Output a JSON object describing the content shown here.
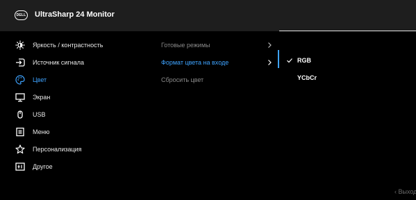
{
  "header": {
    "logo_text": "DELL",
    "title": "UltraSharp 24 Monitor",
    "progress": 1.0
  },
  "menu": {
    "items": [
      {
        "label": "Яркость / контрастность",
        "icon": "brightness-icon"
      },
      {
        "label": "Источник сигнала",
        "icon": "input-source-icon"
      },
      {
        "label": "Цвет",
        "icon": "color-palette-icon",
        "active": true
      },
      {
        "label": "Экран",
        "icon": "display-icon"
      },
      {
        "label": "USB",
        "icon": "usb-mouse-icon"
      },
      {
        "label": "Меню",
        "icon": "menu-list-icon"
      },
      {
        "label": "Персонализация",
        "icon": "star-icon"
      },
      {
        "label": "Другое",
        "icon": "other-info-icon"
      }
    ]
  },
  "submenu": {
    "items": [
      {
        "label": "Готовые режимы",
        "chevron": true
      },
      {
        "label": "Формат цвета на входе",
        "chevron": true,
        "active": true
      },
      {
        "label": "Сбросить цвет",
        "chevron": false
      }
    ]
  },
  "options": {
    "items": [
      {
        "label": "RGB",
        "selected": true
      },
      {
        "label": "YCbCr",
        "selected": false
      }
    ]
  },
  "footer": {
    "exit_label": "‹ Выход"
  },
  "colors": {
    "accent": "#3ea3ff",
    "titlebar": "#1e1e1e",
    "background": "#000000"
  }
}
